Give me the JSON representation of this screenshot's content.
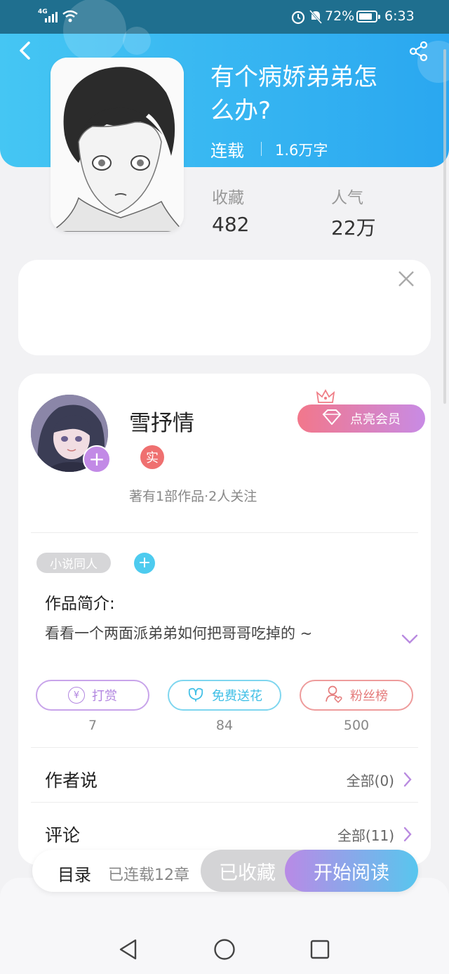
{
  "status_bar": {
    "signal_label": "4G",
    "battery": "72%",
    "time": "6:33"
  },
  "book": {
    "title_line1": "有个病娇弟弟怎",
    "title_line2": "么办?",
    "status": "连载",
    "words": "1.6万字",
    "favorites_label": "收藏",
    "favorites_value": "482",
    "popularity_label": "人气",
    "popularity_value": "22万"
  },
  "author": {
    "name": "雪抒情",
    "badge": "实",
    "member_button": "点亮会员",
    "stats": "著有1部作品·2人关注"
  },
  "intro": {
    "tag": "小说同人",
    "heading": "作品简介:",
    "text": "看看一个两面派弟弟如何把哥哥吃掉的 ~"
  },
  "actions": [
    {
      "label": "打赏",
      "count": "7"
    },
    {
      "label": "免费送花",
      "count": "84"
    },
    {
      "label": "粉丝榜",
      "count": "500"
    }
  ],
  "sections": {
    "author_says": "作者说",
    "author_says_all": "全部(0)",
    "comments": "评论",
    "comments_all": "全部(11)"
  },
  "bottom_bar": {
    "catalog": "目录",
    "chapters": "已连载12章",
    "collected": "已收藏",
    "start_reading": "开始阅读"
  },
  "colors": {
    "header_start": "#45c6f3",
    "header_end": "#2aa7f0",
    "purple": "#c28ae6",
    "cyan": "#4dcbef",
    "coral": "#e98a8a"
  }
}
